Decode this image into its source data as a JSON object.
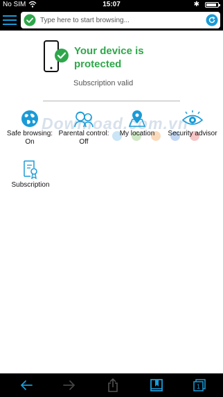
{
  "status_bar": {
    "carrier": "No SIM",
    "time": "15:07",
    "battery_level": 0.9
  },
  "search": {
    "placeholder": "Type here to start browsing..."
  },
  "protection": {
    "title": "Your device is protected",
    "subtitle": "Subscription valid"
  },
  "features": [
    {
      "label": "Safe browsing:",
      "value": "On",
      "icon": "globe-icon"
    },
    {
      "label": "Parental control:",
      "value": "Off",
      "icon": "family-icon"
    },
    {
      "label": "My location",
      "value": "",
      "icon": "map-pin-icon"
    },
    {
      "label": "Security advisor",
      "value": "",
      "icon": "eye-icon"
    },
    {
      "label": "Subscription",
      "value": "",
      "icon": "certificate-icon"
    }
  ],
  "watermark": "Download.com.vn",
  "colors": {
    "accent": "#1a9bd7",
    "protected_green": "#2ea74a",
    "bar_background": "#000000"
  }
}
